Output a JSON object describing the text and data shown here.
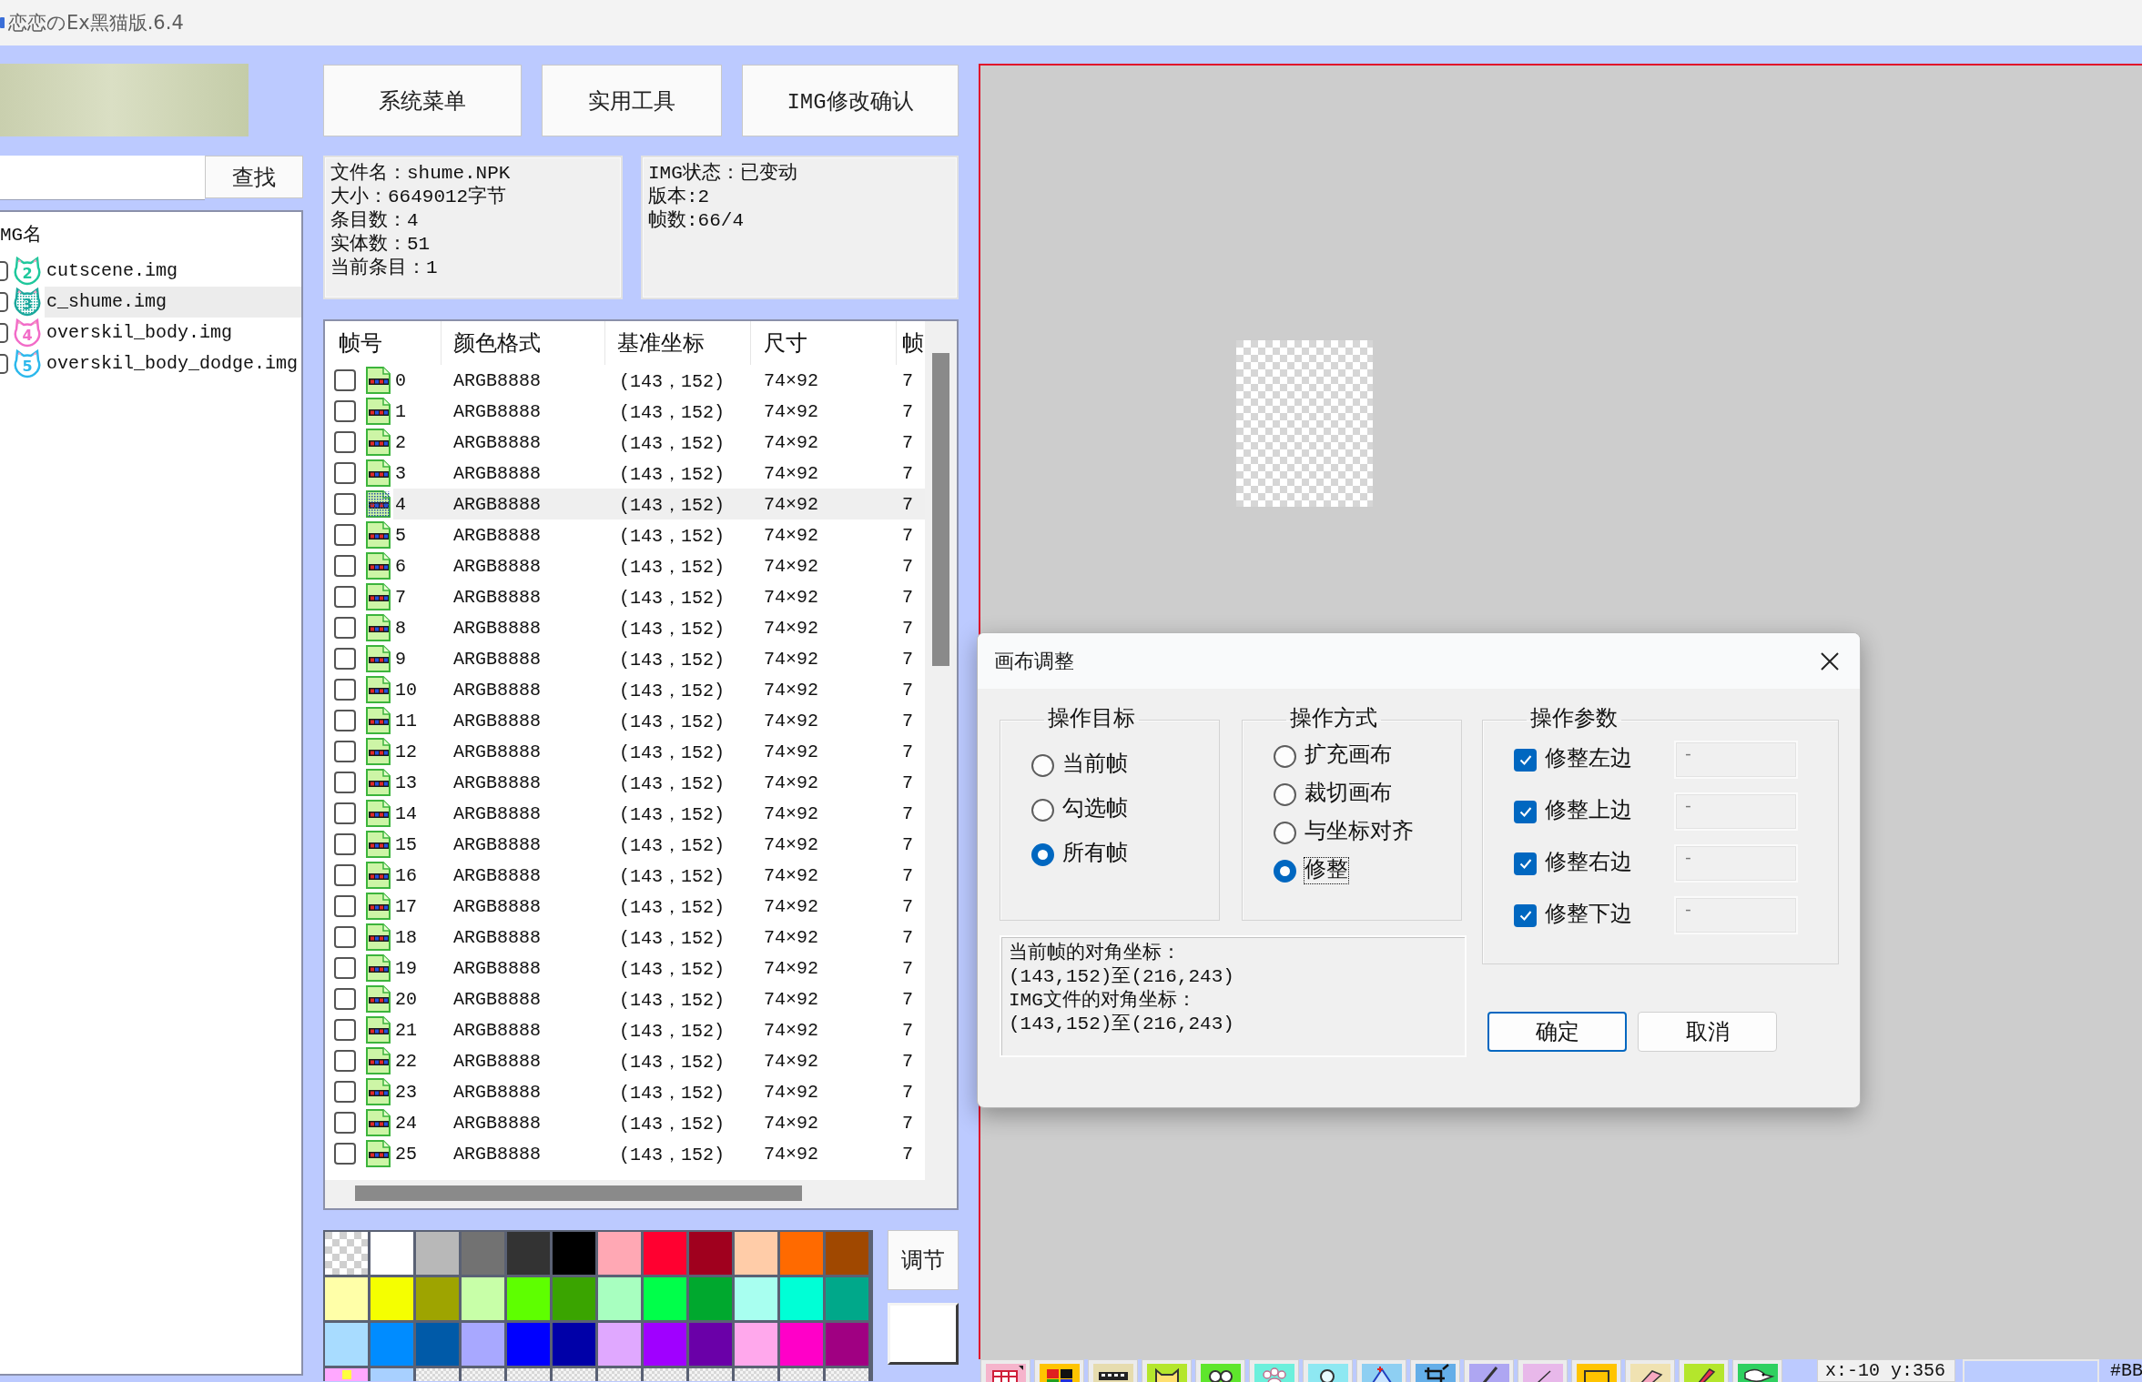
{
  "window": {
    "title": "恋恋のEx黑猫版.6.4"
  },
  "search": {
    "button": "查找"
  },
  "img_list": {
    "header": "MG名",
    "items": [
      {
        "badge": "2",
        "color": "#1fc89c",
        "name": "cutscene.img",
        "checked": false,
        "selected": false
      },
      {
        "badge": "3",
        "color": "#1aa89c",
        "name": "c_shume.img",
        "checked": false,
        "selected": true
      },
      {
        "badge": "4",
        "color": "#f26cc8",
        "name": "overskil_body.img",
        "checked": false,
        "selected": false
      },
      {
        "badge": "5",
        "color": "#2cb8ec",
        "name": "overskil_body_dodge.img",
        "checked": false,
        "selected": false
      }
    ]
  },
  "menu_buttons": [
    "系统菜单",
    "实用工具",
    "IMG修改确认"
  ],
  "file_info": [
    "文件名：shume.NPK",
    "大小：6649012字节",
    "条目数：4",
    "实体数：51",
    "当前条目：1"
  ],
  "img_info": [
    "IMG状态：已变动",
    "版本:2",
    "帧数:66/4"
  ],
  "frames": {
    "columns": [
      "帧号",
      "颜色格式",
      "基准坐标",
      "尺寸",
      "帧"
    ],
    "rows": [
      {
        "number": "0",
        "format": "ARGB8888",
        "base": "(143，152)",
        "size": "74×92",
        "column_5": "7",
        "checked": false,
        "selected": false
      },
      {
        "number": "1",
        "format": "ARGB8888",
        "base": "(143，152)",
        "size": "74×92",
        "column_5": "7",
        "checked": false,
        "selected": false
      },
      {
        "number": "2",
        "format": "ARGB8888",
        "base": "(143，152)",
        "size": "74×92",
        "column_5": "7",
        "checked": false,
        "selected": false
      },
      {
        "number": "3",
        "format": "ARGB8888",
        "base": "(143，152)",
        "size": "74×92",
        "column_5": "7",
        "checked": false,
        "selected": false
      },
      {
        "number": "4",
        "format": "ARGB8888",
        "base": "(143，152)",
        "size": "74×92",
        "column_5": "7",
        "checked": false,
        "selected": true
      },
      {
        "number": "5",
        "format": "ARGB8888",
        "base": "(143，152)",
        "size": "74×92",
        "column_5": "7",
        "checked": false,
        "selected": false
      },
      {
        "number": "6",
        "format": "ARGB8888",
        "base": "(143，152)",
        "size": "74×92",
        "column_5": "7",
        "checked": false,
        "selected": false
      },
      {
        "number": "7",
        "format": "ARGB8888",
        "base": "(143，152)",
        "size": "74×92",
        "column_5": "7",
        "checked": false,
        "selected": false
      },
      {
        "number": "8",
        "format": "ARGB8888",
        "base": "(143，152)",
        "size": "74×92",
        "column_5": "7",
        "checked": false,
        "selected": false
      },
      {
        "number": "9",
        "format": "ARGB8888",
        "base": "(143，152)",
        "size": "74×92",
        "column_5": "7",
        "checked": false,
        "selected": false
      },
      {
        "number": "10",
        "format": "ARGB8888",
        "base": "(143，152)",
        "size": "74×92",
        "column_5": "7",
        "checked": false,
        "selected": false
      },
      {
        "number": "11",
        "format": "ARGB8888",
        "base": "(143，152)",
        "size": "74×92",
        "column_5": "7",
        "checked": false,
        "selected": false
      },
      {
        "number": "12",
        "format": "ARGB8888",
        "base": "(143，152)",
        "size": "74×92",
        "column_5": "7",
        "checked": false,
        "selected": false
      },
      {
        "number": "13",
        "format": "ARGB8888",
        "base": "(143，152)",
        "size": "74×92",
        "column_5": "7",
        "checked": false,
        "selected": false
      },
      {
        "number": "14",
        "format": "ARGB8888",
        "base": "(143，152)",
        "size": "74×92",
        "column_5": "7",
        "checked": false,
        "selected": false
      },
      {
        "number": "15",
        "format": "ARGB8888",
        "base": "(143，152)",
        "size": "74×92",
        "column_5": "7",
        "checked": false,
        "selected": false
      },
      {
        "number": "16",
        "format": "ARGB8888",
        "base": "(143，152)",
        "size": "74×92",
        "column_5": "7",
        "checked": false,
        "selected": false
      },
      {
        "number": "17",
        "format": "ARGB8888",
        "base": "(143，152)",
        "size": "74×92",
        "column_5": "7",
        "checked": false,
        "selected": false
      },
      {
        "number": "18",
        "format": "ARGB8888",
        "base": "(143，152)",
        "size": "74×92",
        "column_5": "7",
        "checked": false,
        "selected": false
      },
      {
        "number": "19",
        "format": "ARGB8888",
        "base": "(143，152)",
        "size": "74×92",
        "column_5": "7",
        "checked": false,
        "selected": false
      },
      {
        "number": "20",
        "format": "ARGB8888",
        "base": "(143，152)",
        "size": "74×92",
        "column_5": "7",
        "checked": false,
        "selected": false
      },
      {
        "number": "21",
        "format": "ARGB8888",
        "base": "(143，152)",
        "size": "74×92",
        "column_5": "7",
        "checked": false,
        "selected": false
      },
      {
        "number": "22",
        "format": "ARGB8888",
        "base": "(143，152)",
        "size": "74×92",
        "column_5": "7",
        "checked": false,
        "selected": false
      },
      {
        "number": "23",
        "format": "ARGB8888",
        "base": "(143，152)",
        "size": "74×92",
        "column_5": "7",
        "checked": false,
        "selected": false
      },
      {
        "number": "24",
        "format": "ARGB8888",
        "base": "(143，152)",
        "size": "74×92",
        "column_5": "7",
        "checked": false,
        "selected": false
      },
      {
        "number": "25",
        "format": "ARGB8888",
        "base": "(143，152)",
        "size": "74×92",
        "column_5": "7",
        "checked": false,
        "selected": false
      }
    ]
  },
  "palette": {
    "swatches": [
      {
        "kind": "transparent",
        "selected": false
      },
      {
        "kind": "color",
        "color": "#ffffff",
        "selected": false
      },
      {
        "kind": "color",
        "color": "#b8b8b8",
        "selected": false
      },
      {
        "kind": "color",
        "color": "#727272",
        "selected": false
      },
      {
        "kind": "color",
        "color": "#333333",
        "selected": false
      },
      {
        "kind": "color",
        "color": "#000000",
        "selected": false
      },
      {
        "kind": "color",
        "color": "#ffa8b4",
        "selected": false
      },
      {
        "kind": "color",
        "color": "#ff0030",
        "selected": false
      },
      {
        "kind": "color",
        "color": "#a0001e",
        "selected": false
      },
      {
        "kind": "color",
        "color": "#ffcca8",
        "selected": false
      },
      {
        "kind": "color",
        "color": "#ff6a00",
        "selected": false
      },
      {
        "kind": "color",
        "color": "#a04800",
        "selected": false
      },
      {
        "kind": "color",
        "color": "#ffffa8",
        "selected": false
      },
      {
        "kind": "color",
        "color": "#f5ff00",
        "selected": false
      },
      {
        "kind": "color",
        "color": "#9ea400",
        "selected": false
      },
      {
        "kind": "color",
        "color": "#c8ffa8",
        "selected": false
      },
      {
        "kind": "color",
        "color": "#5eff00",
        "selected": false
      },
      {
        "kind": "color",
        "color": "#3aa400",
        "selected": false
      },
      {
        "kind": "color",
        "color": "#a8ffc0",
        "selected": false
      },
      {
        "kind": "color",
        "color": "#00ff4a",
        "selected": false
      },
      {
        "kind": "color",
        "color": "#00a82e",
        "selected": false
      },
      {
        "kind": "color",
        "color": "#a8fff0",
        "selected": false
      },
      {
        "kind": "color",
        "color": "#00ffd6",
        "selected": false
      },
      {
        "kind": "color",
        "color": "#00a88a",
        "selected": false
      },
      {
        "kind": "color",
        "color": "#a8dcff",
        "selected": false
      },
      {
        "kind": "color",
        "color": "#008cff",
        "selected": false
      },
      {
        "kind": "color",
        "color": "#005aa8",
        "selected": false
      },
      {
        "kind": "color",
        "color": "#a8a8ff",
        "selected": false
      },
      {
        "kind": "color",
        "color": "#0000ff",
        "selected": false
      },
      {
        "kind": "color",
        "color": "#0000a8",
        "selected": false
      },
      {
        "kind": "color",
        "color": "#e0a8ff",
        "selected": false
      },
      {
        "kind": "color",
        "color": "#a000ff",
        "selected": false
      },
      {
        "kind": "color",
        "color": "#6a00a8",
        "selected": false
      },
      {
        "kind": "color",
        "color": "#ffa8ec",
        "selected": false
      },
      {
        "kind": "color",
        "color": "#ff00c8",
        "selected": false
      },
      {
        "kind": "color",
        "color": "#a00082",
        "selected": false
      },
      {
        "kind": "color",
        "color": "#ffa8ff",
        "selected": true
      },
      {
        "kind": "color",
        "color": "#a8d0ff",
        "selected": false
      },
      {
        "kind": "empty",
        "selected": false
      },
      {
        "kind": "empty",
        "selected": false
      },
      {
        "kind": "empty",
        "selected": false
      },
      {
        "kind": "empty",
        "selected": false
      },
      {
        "kind": "empty",
        "selected": false
      },
      {
        "kind": "empty",
        "selected": false
      },
      {
        "kind": "empty",
        "selected": false
      },
      {
        "kind": "empty",
        "selected": false
      },
      {
        "kind": "empty",
        "selected": false
      },
      {
        "kind": "empty",
        "selected": false
      }
    ],
    "adjust_button": "调节",
    "current": {
      "color": "#ffffff"
    }
  },
  "dialog": {
    "title": "画布调整",
    "target": {
      "label": "操作目标",
      "options": [
        {
          "label": "当前帧",
          "selected": false
        },
        {
          "label": "勾选帧",
          "selected": false
        },
        {
          "label": "所有帧",
          "selected": true
        }
      ]
    },
    "mode": {
      "label": "操作方式",
      "options": [
        {
          "label": "扩充画布",
          "selected": false,
          "focused": false
        },
        {
          "label": "裁切画布",
          "selected": false,
          "focused": false
        },
        {
          "label": "与坐标对齐",
          "selected": false,
          "focused": false
        },
        {
          "label": "修整",
          "selected": true,
          "focused": true
        }
      ]
    },
    "params": {
      "label": "操作参数",
      "items": [
        {
          "label": "修整左边",
          "checked": true,
          "value": "-"
        },
        {
          "label": "修整上边",
          "checked": true,
          "value": "-"
        },
        {
          "label": "修整右边",
          "checked": true,
          "value": "-"
        },
        {
          "label": "修整下边",
          "checked": true,
          "value": "-"
        }
      ]
    },
    "info_lines": [
      "当前帧的对角坐标：",
      "(143,152)至(216,243)",
      "IMG文件的对角坐标：",
      "(143,152)至(216,243)"
    ],
    "buttons": [
      {
        "label": "确定",
        "default": true
      },
      {
        "label": "取消",
        "default": false
      }
    ]
  },
  "status_bar": {
    "coords": "x:-10 y:356",
    "color": "#bbccff",
    "color_code": "#BB"
  }
}
